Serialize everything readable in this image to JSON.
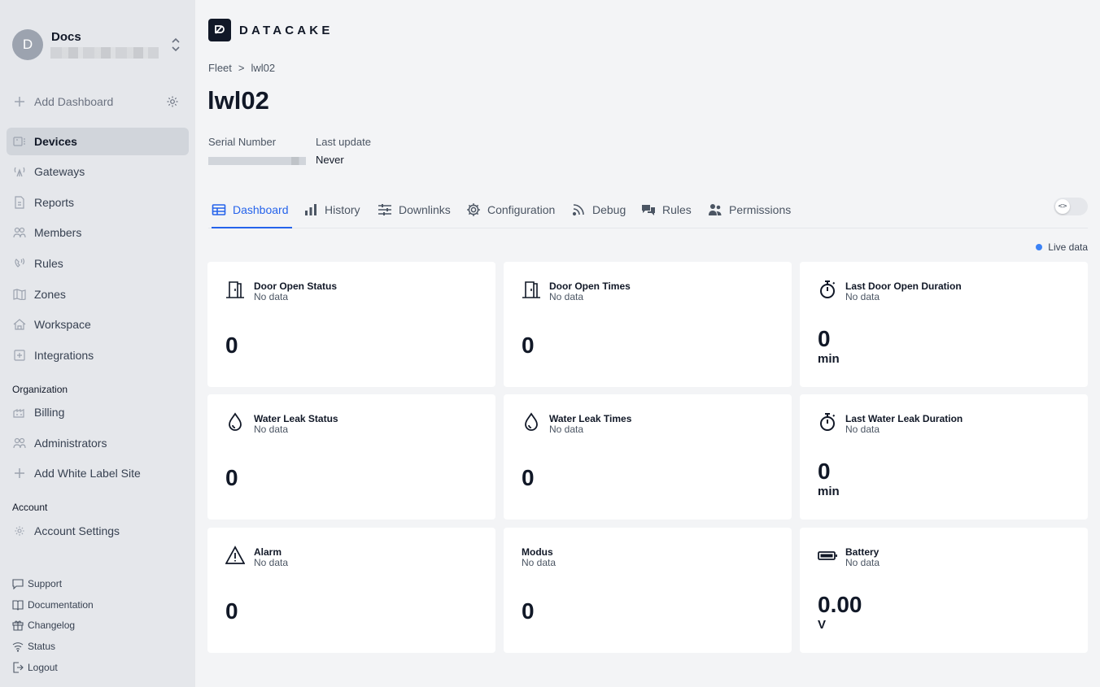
{
  "workspace": {
    "initial": "D",
    "name": "Docs"
  },
  "sidebar": {
    "add_dashboard": "Add Dashboard",
    "items": [
      {
        "label": "Devices",
        "icon": "devices-icon"
      },
      {
        "label": "Gateways",
        "icon": "gateway-icon"
      },
      {
        "label": "Reports",
        "icon": "report-icon"
      },
      {
        "label": "Members",
        "icon": "members-icon"
      },
      {
        "label": "Rules",
        "icon": "rules-icon"
      },
      {
        "label": "Zones",
        "icon": "map-icon"
      },
      {
        "label": "Workspace",
        "icon": "house-icon"
      },
      {
        "label": "Integrations",
        "icon": "plus-square-icon"
      }
    ],
    "org_heading": "Organization",
    "org_items": [
      {
        "label": "Billing",
        "icon": "billing-icon"
      },
      {
        "label": "Administrators",
        "icon": "admins-icon"
      },
      {
        "label": "Add White Label Site",
        "icon": "plus-icon"
      }
    ],
    "account_heading": "Account",
    "account_items": [
      {
        "label": "Account Settings",
        "icon": "gear-icon"
      }
    ],
    "footer": [
      {
        "label": "Support",
        "icon": "chat-icon"
      },
      {
        "label": "Documentation",
        "icon": "book-icon"
      },
      {
        "label": "Changelog",
        "icon": "gift-icon"
      },
      {
        "label": "Status",
        "icon": "wifi-icon"
      },
      {
        "label": "Logout",
        "icon": "logout-icon"
      }
    ]
  },
  "header": {
    "logo": "DATACAKE",
    "breadcrumb": [
      "Fleet",
      ">",
      "lwl02"
    ],
    "title": "lwl02",
    "serial_label": "Serial Number",
    "last_update_label": "Last update",
    "last_update_value": "Never"
  },
  "tabs": [
    {
      "label": "Dashboard",
      "icon": "table-icon",
      "active": true
    },
    {
      "label": "History",
      "icon": "bar-chart-icon"
    },
    {
      "label": "Downlinks",
      "icon": "sliders-icon"
    },
    {
      "label": "Configuration",
      "icon": "gear-icon"
    },
    {
      "label": "Debug",
      "icon": "rss-icon"
    },
    {
      "label": "Rules",
      "icon": "comments-icon"
    },
    {
      "label": "Permissions",
      "icon": "users-icon"
    }
  ],
  "toggle_label": "<>",
  "live_label": "Live data",
  "accent_color": "#2563eb",
  "widgets": [
    {
      "title": "Door Open Status",
      "sub": "No data",
      "value": "0",
      "unit": "",
      "icon": "door-icon"
    },
    {
      "title": "Door Open Times",
      "sub": "No data",
      "value": "0",
      "unit": "",
      "icon": "door-icon"
    },
    {
      "title": "Last Door Open Duration",
      "sub": "No data",
      "value": "0",
      "unit": "min",
      "icon": "stopwatch-icon"
    },
    {
      "title": "Water Leak Status",
      "sub": "No data",
      "value": "0",
      "unit": "",
      "icon": "droplet-icon"
    },
    {
      "title": "Water Leak Times",
      "sub": "No data",
      "value": "0",
      "unit": "",
      "icon": "droplet-icon"
    },
    {
      "title": "Last Water Leak Duration",
      "sub": "No data",
      "value": "0",
      "unit": "min",
      "icon": "stopwatch-icon"
    },
    {
      "title": "Alarm",
      "sub": "No data",
      "value": "0",
      "unit": "",
      "icon": "warning-icon"
    },
    {
      "title": "Modus",
      "sub": "No data",
      "value": "0",
      "unit": "",
      "icon": ""
    },
    {
      "title": "Battery",
      "sub": "No data",
      "value": "0.00",
      "unit": "V",
      "icon": "battery-icon"
    }
  ]
}
